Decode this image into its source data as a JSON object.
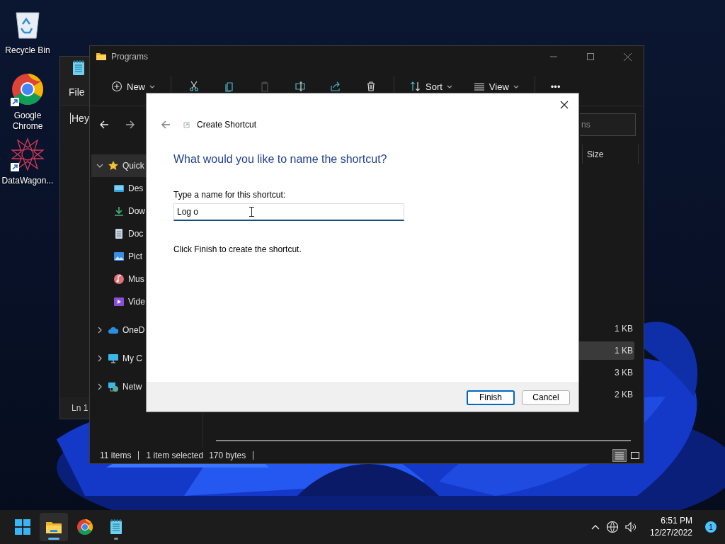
{
  "desktop_icons": [
    {
      "label": "Recycle Bin",
      "kind": "recycle",
      "shortcut": false
    },
    {
      "label": "Google Chrome",
      "kind": "chrome",
      "shortcut": true
    },
    {
      "label": "DataWagon...",
      "kind": "star",
      "shortcut": true
    }
  ],
  "notepad": {
    "menu": [
      "File"
    ],
    "text": "Hey",
    "status": "Ln 1"
  },
  "explorer": {
    "title": "Programs",
    "toolbar": [
      {
        "kind": "new",
        "label": "New",
        "disabled": false
      },
      {
        "kind": "cut",
        "disabled": false
      },
      {
        "kind": "copy",
        "disabled": false
      },
      {
        "kind": "paste",
        "disabled": true
      },
      {
        "kind": "rename",
        "disabled": false
      },
      {
        "kind": "share",
        "disabled": false
      },
      {
        "kind": "delete",
        "disabled": false
      },
      {
        "kind": "sort",
        "label": "Sort",
        "disabled": false
      },
      {
        "kind": "view",
        "label": "View",
        "disabled": false
      },
      {
        "kind": "more",
        "label": "•••",
        "disabled": false
      }
    ],
    "search": {
      "placeholder": "ns"
    },
    "columns": [
      "Size"
    ],
    "nav": [
      {
        "label": "Quick",
        "kind": "star",
        "expanded": true,
        "selected": true,
        "children": [
          {
            "label": "Des",
            "kind": "desktop",
            "selected": false
          },
          {
            "label": "Dow",
            "kind": "download",
            "selected": false
          },
          {
            "label": "Doc",
            "kind": "document",
            "selected": false
          },
          {
            "label": "Pict",
            "kind": "pictures",
            "selected": false
          },
          {
            "label": "Mus",
            "kind": "music",
            "selected": false
          },
          {
            "label": "Vide",
            "kind": "video",
            "selected": false
          }
        ]
      },
      {
        "label": "OneD",
        "kind": "cloud",
        "expanded": false,
        "selected": false
      },
      {
        "label": "My C",
        "kind": "pc",
        "expanded": false,
        "selected": false
      },
      {
        "label": "Netw",
        "kind": "network",
        "expanded": false,
        "selected": false
      }
    ],
    "rows": [
      {
        "size": "1 KB",
        "selected": false
      },
      {
        "size": "1 KB",
        "selected": true
      },
      {
        "size": "3 KB",
        "selected": false
      },
      {
        "size": "2 KB",
        "selected": false
      }
    ],
    "status": {
      "items": "11 items",
      "selection": "1 item selected",
      "size": "170 bytes"
    },
    "views": [
      {
        "kind": "details",
        "selected": true
      },
      {
        "kind": "tiles",
        "selected": false
      }
    ]
  },
  "dialog": {
    "title": "Create Shortcut",
    "heading": "What would you like to name the shortcut?",
    "field_label": "Type a name for this shortcut:",
    "value": "Log o",
    "hint": "Click Finish to create the shortcut.",
    "buttons": [
      {
        "label": "Finish",
        "default": true
      },
      {
        "label": "Cancel",
        "default": false
      }
    ]
  },
  "taskbar": {
    "apps": [
      {
        "kind": "start",
        "active": false,
        "running": false
      },
      {
        "kind": "explorer",
        "active": true,
        "running": true
      },
      {
        "kind": "chrome",
        "active": false,
        "running": false
      },
      {
        "kind": "notepad",
        "active": false,
        "running": true
      }
    ],
    "time": "6:51 PM",
    "date": "12/27/2022",
    "notifications": "1"
  }
}
